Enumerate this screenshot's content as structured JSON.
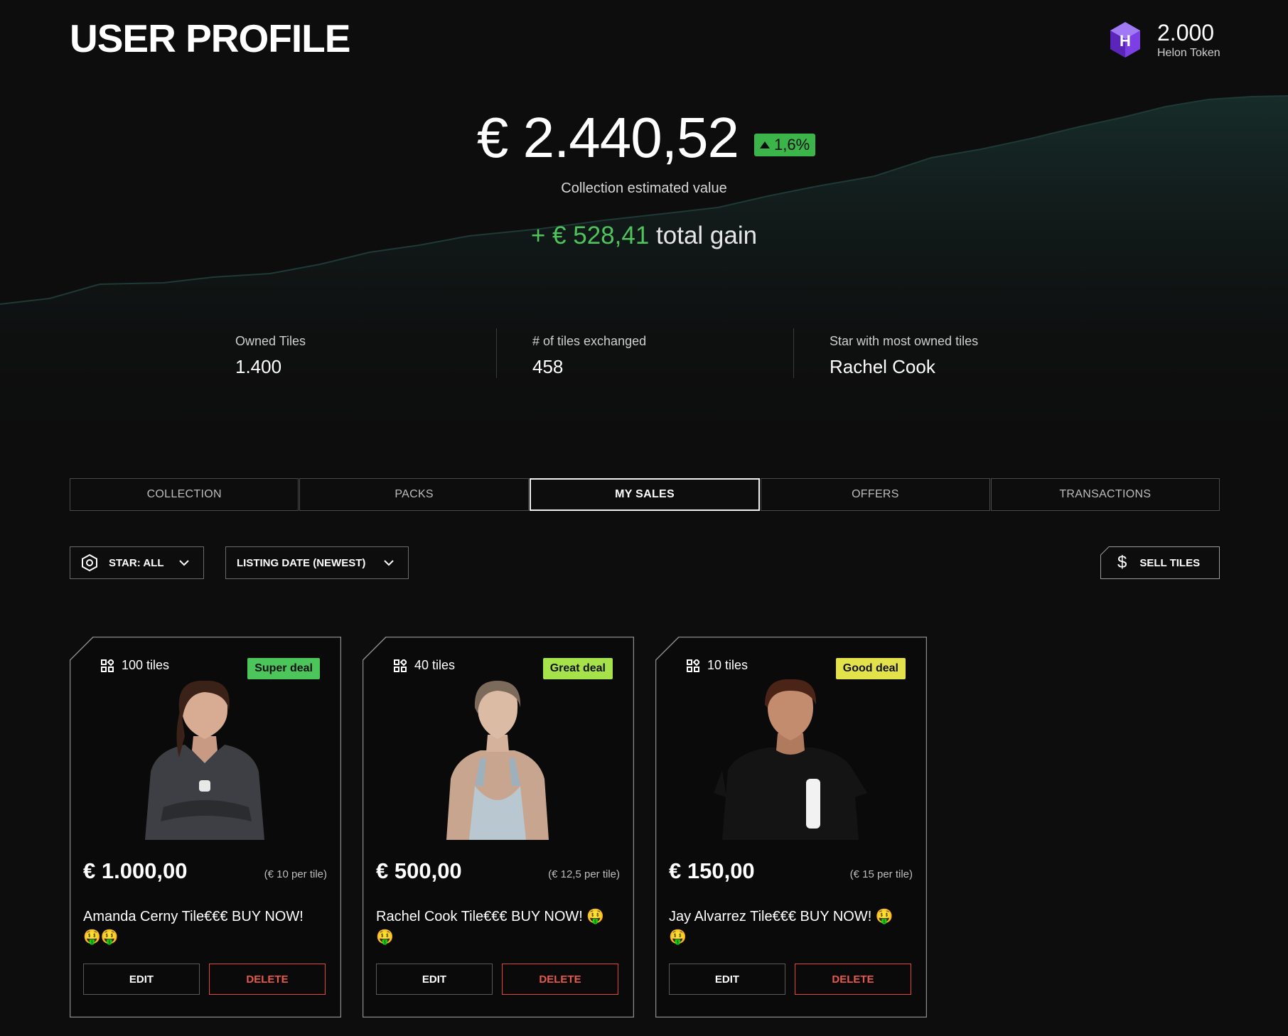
{
  "header": {
    "title": "USER PROFILE",
    "token_amount": "2.000",
    "token_label": "Helon Token",
    "token_logo_letter": "H"
  },
  "summary": {
    "estimated_value": "€ 2.440,52",
    "change": "1,6%",
    "change_direction": "up",
    "caption": "Collection estimated value",
    "gain_value": "+ € 528,41",
    "gain_text": "total gain"
  },
  "stats": [
    {
      "label": "Owned Tiles",
      "value": "1.400"
    },
    {
      "label": "# of tiles exchanged",
      "value": "458"
    },
    {
      "label": "Star with most owned tiles",
      "value": "Rachel Cook"
    }
  ],
  "tabs": [
    {
      "label": "COLLECTION",
      "active": false
    },
    {
      "label": "PACKS",
      "active": false
    },
    {
      "label": "MY SALES",
      "active": true
    },
    {
      "label": "OFFERS",
      "active": false
    },
    {
      "label": "TRANSACTIONS",
      "active": false
    }
  ],
  "filters": {
    "star": "STAR: ALL",
    "sort": "LISTING DATE (NEWEST)",
    "sell_button": "SELL TILES"
  },
  "cards": [
    {
      "tiles": "100 tiles",
      "deal": "Super deal",
      "deal_color": "#4cc65a",
      "price": "€ 1.000,00",
      "per_tile": "(€ 10 per tile)",
      "title": "Amanda Cerny Tile€€€ BUY NOW! 🤑🤑",
      "edit": "EDIT",
      "delete": "DELETE"
    },
    {
      "tiles": "40 tiles",
      "deal": "Great deal",
      "deal_color": "#a6e24a",
      "price": "€ 500,00",
      "per_tile": "(€ 12,5 per tile)",
      "title": "Rachel Cook Tile€€€ BUY NOW! 🤑🤑",
      "edit": "EDIT",
      "delete": "DELETE"
    },
    {
      "tiles": "10 tiles",
      "deal": "Good deal",
      "deal_color": "#e3e24a",
      "price": "€ 150,00",
      "per_tile": "(€ 15 per tile)",
      "title": "Jay Alvarrez Tile€€€ BUY NOW! 🤑🤑",
      "edit": "EDIT",
      "delete": "DELETE"
    }
  ],
  "colors": {
    "background": "#0d0d0d",
    "gain_green": "#4fc35c",
    "delete_red": "#e0473a",
    "token_purple": "#7b3fe4"
  }
}
